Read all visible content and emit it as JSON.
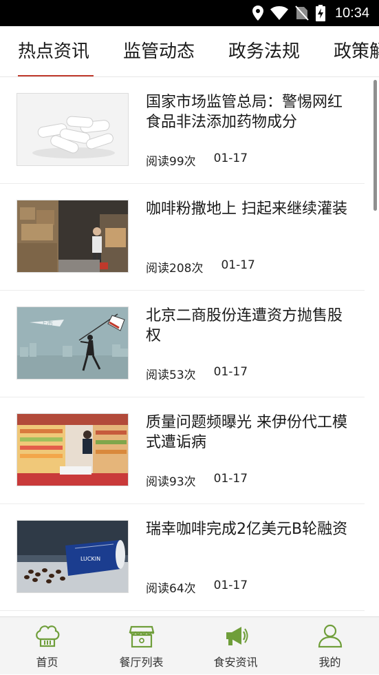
{
  "status_bar": {
    "time": "10:34",
    "icons": [
      "location-icon",
      "wifi-icon",
      "no-sim-icon",
      "battery-charging-icon"
    ]
  },
  "tabs": [
    {
      "label": "热点资讯",
      "active": true
    },
    {
      "label": "监管动态",
      "active": false
    },
    {
      "label": "政务法规",
      "active": false
    },
    {
      "label": "政策解读",
      "active": false
    }
  ],
  "articles": [
    {
      "title": "国家市场监管总局：警惕网红食品非法添加药物成分",
      "reads": "阅读99次",
      "date": "01-17",
      "thumb": "capsules-image"
    },
    {
      "title": "咖啡粉撒地上 扫起来继续灌装",
      "reads": "阅读208次",
      "date": "01-17",
      "thumb": "warehouse-image"
    },
    {
      "title": "北京二商股份连遭资方抛售股权",
      "reads": "阅读53次",
      "date": "01-17",
      "thumb": "flag-image"
    },
    {
      "title": "质量问题频曝光 来伊份代工模式遭诟病",
      "reads": "阅读93次",
      "date": "01-17",
      "thumb": "store-image"
    },
    {
      "title": "瑞幸咖啡完成2亿美元B轮融资",
      "reads": "阅读64次",
      "date": "01-17",
      "thumb": "coffee-cup-image"
    }
  ],
  "bottom_nav": [
    {
      "label": "首页",
      "icon": "chef-hat-icon",
      "active": false
    },
    {
      "label": "餐厅列表",
      "icon": "storefront-icon",
      "active": false
    },
    {
      "label": "食安资讯",
      "icon": "megaphone-icon",
      "active": true
    },
    {
      "label": "我的",
      "icon": "person-icon",
      "active": false
    }
  ],
  "colors": {
    "accent": "#c0392b",
    "nav_icon_green": "#6f9e3a",
    "status_bar": "#000000"
  }
}
